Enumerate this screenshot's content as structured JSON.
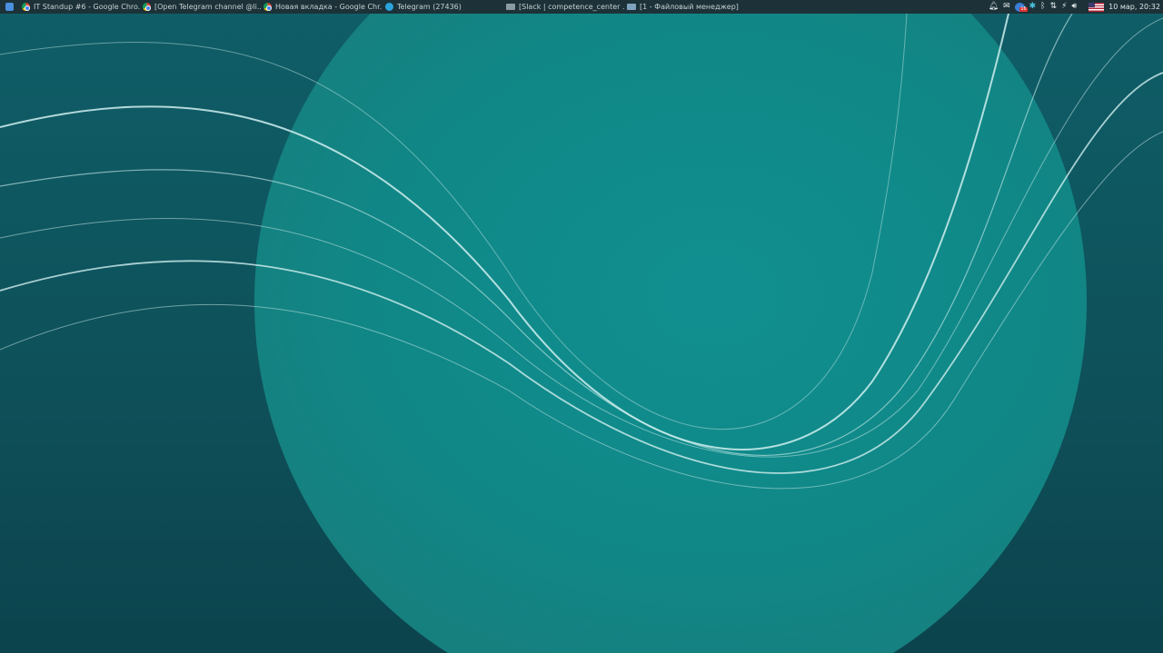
{
  "taskbar": {
    "tasks": [
      {
        "label": "IT Standup #6 - Google Chro...",
        "icon": "chrome-icon"
      },
      {
        "label": "[Open Telegram channel @li...",
        "icon": "chrome-icon"
      },
      {
        "label": "Новая вкладка - Google Chr...",
        "icon": "chrome-icon"
      },
      {
        "label": "Telegram (27436)",
        "icon": "telegram-icon"
      },
      {
        "label": "[Slack | competence_center ...",
        "icon": "window-icon"
      },
      {
        "label": "[1 - Файловый менеджер]",
        "icon": "folder-icon"
      }
    ],
    "clock": "10 мар, 20:32",
    "tray_badge": "16"
  },
  "colors": {
    "panel": "#1c3238",
    "circle": "#128c8c",
    "background": "#0e5560"
  }
}
